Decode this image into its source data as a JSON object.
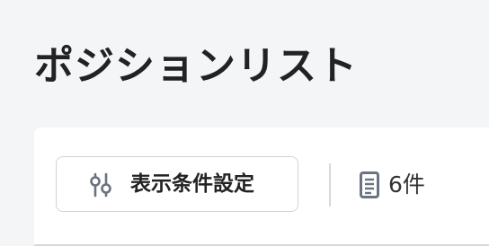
{
  "header": {
    "title": "ポジションリスト"
  },
  "toolbar": {
    "filter_button_label": "表示条件設定",
    "filter_icon": "sliders-icon",
    "result_icon": "document-icon",
    "result_count_text": "6件"
  },
  "colors": {
    "page_background": "#f4f5f7",
    "card_background": "#ffffff",
    "text": "#222222",
    "border": "#cfd3d7",
    "icon_gray": "#6b7280"
  }
}
